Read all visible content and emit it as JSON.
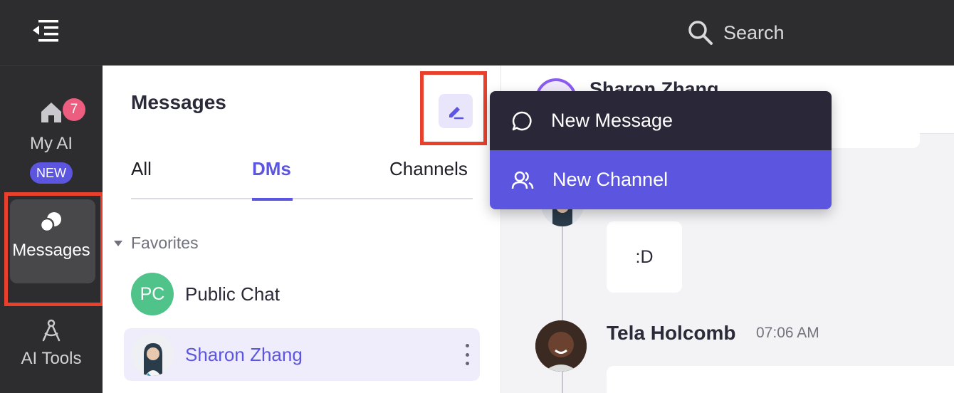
{
  "topbar": {
    "search_placeholder": "Search",
    "menu_icon": "collapse-menu-icon",
    "search_icon": "search-icon"
  },
  "rail": {
    "items": [
      {
        "label": "My AI",
        "icon": "home-icon",
        "badge": "7",
        "tag": "NEW"
      },
      {
        "label": "Messages",
        "icon": "chat-bubbles-icon"
      },
      {
        "label": "AI Tools",
        "icon": "compass-icon"
      }
    ]
  },
  "panel": {
    "title": "Messages",
    "compose_icon": "pencil-icon",
    "tabs": [
      "All",
      "DMs",
      "Channels"
    ],
    "active_tab": "DMs",
    "section": "Favorites",
    "conversations": [
      {
        "initials": "PC",
        "name": "Public Chat",
        "avatar_color": "#4fc38a"
      },
      {
        "name": "Sharon Zhang",
        "selected": true
      }
    ]
  },
  "chat": {
    "header_name": "Sharon Zhang",
    "messages": [
      {
        "text": ":D"
      },
      {
        "author": "Tela Holcomb",
        "time": "07:06 AM"
      }
    ]
  },
  "dropdown": {
    "items": [
      {
        "label": "New Message",
        "icon": "message-circle-icon"
      },
      {
        "label": "New Channel",
        "icon": "users-icon"
      }
    ]
  },
  "colors": {
    "accent": "#5b55e0",
    "highlight": "#e8402a",
    "badge": "#ec5d80"
  }
}
